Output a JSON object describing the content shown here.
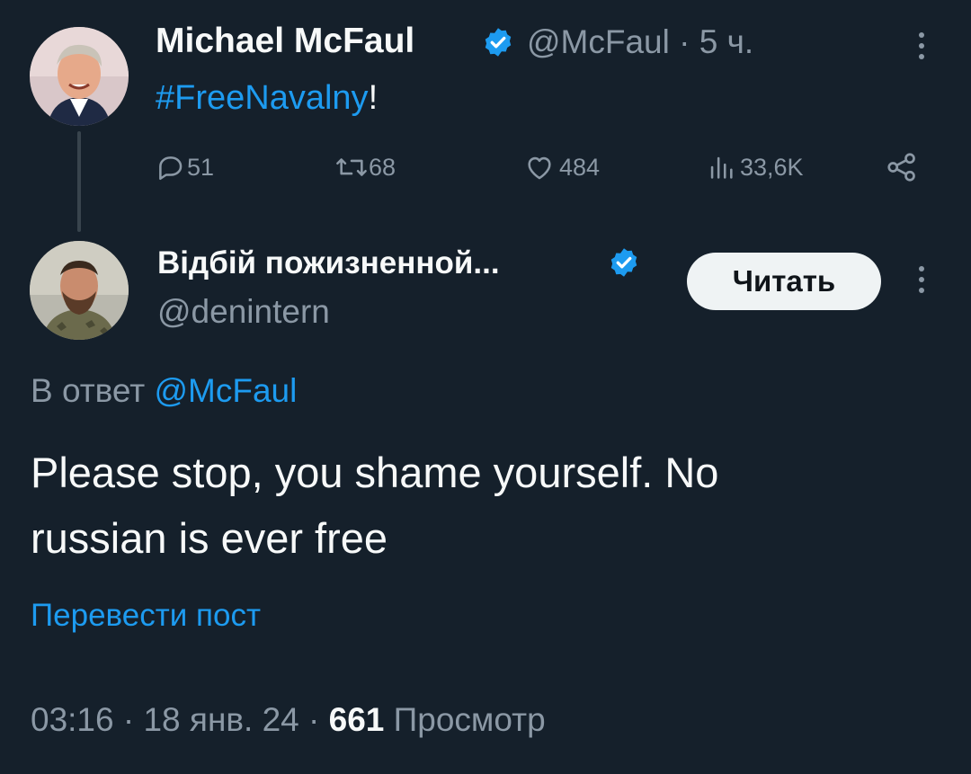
{
  "parent_tweet": {
    "author_name": "Michael McFaul",
    "handle": "@McFaul",
    "separator": "·",
    "time_ago": "5 ч.",
    "text_hashtag": "#FreeNavalny",
    "text_suffix": "!",
    "stats": {
      "replies": "51",
      "retweets": "68",
      "likes": "484",
      "views": "33,6K"
    }
  },
  "reply_tweet": {
    "author_name": "Відбій пожизненной...",
    "handle": "@denintern",
    "follow_label": "Читать",
    "reply_to_prefix": "В ответ",
    "reply_to_handle": "@McFaul",
    "text_line1": "Please stop, you shame yourself. No",
    "text_line2": "russian is ever free",
    "translate_label": "Перевести пост",
    "time": "03:16",
    "separator": "·",
    "date": "18 янв. 24",
    "views_count": "661",
    "views_label": "Просмотр"
  },
  "colors": {
    "background": "#15202b",
    "text": "#f7f9f9",
    "muted": "#8b98a5",
    "accent": "#1d9bf0"
  },
  "icons": [
    "verified-badge-icon",
    "more-options-icon",
    "reply-icon",
    "retweet-icon",
    "like-icon",
    "views-icon",
    "share-icon"
  ]
}
